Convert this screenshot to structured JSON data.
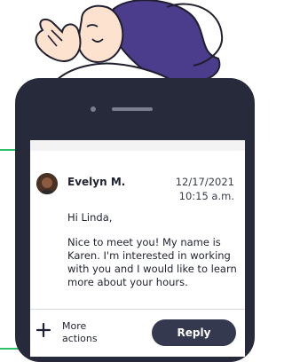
{
  "message": {
    "sender": "Evelyn M.",
    "date": "12/17/2021",
    "time": "10:15 a.m.",
    "greeting": "Hi Linda,",
    "body": "Nice to meet you! My name is Karen. I'm interested in working with you and I would like to learn more about your hours."
  },
  "actions": {
    "more_label": "More actions",
    "reply_label": "Reply"
  },
  "colors": {
    "accent_green": "#2fbf6b",
    "phone_frame": "#262a3b",
    "reply_button": "#34394f",
    "hair": "#4b3c8c"
  },
  "icons": {
    "add": "plus-icon",
    "avatar": "avatar"
  }
}
